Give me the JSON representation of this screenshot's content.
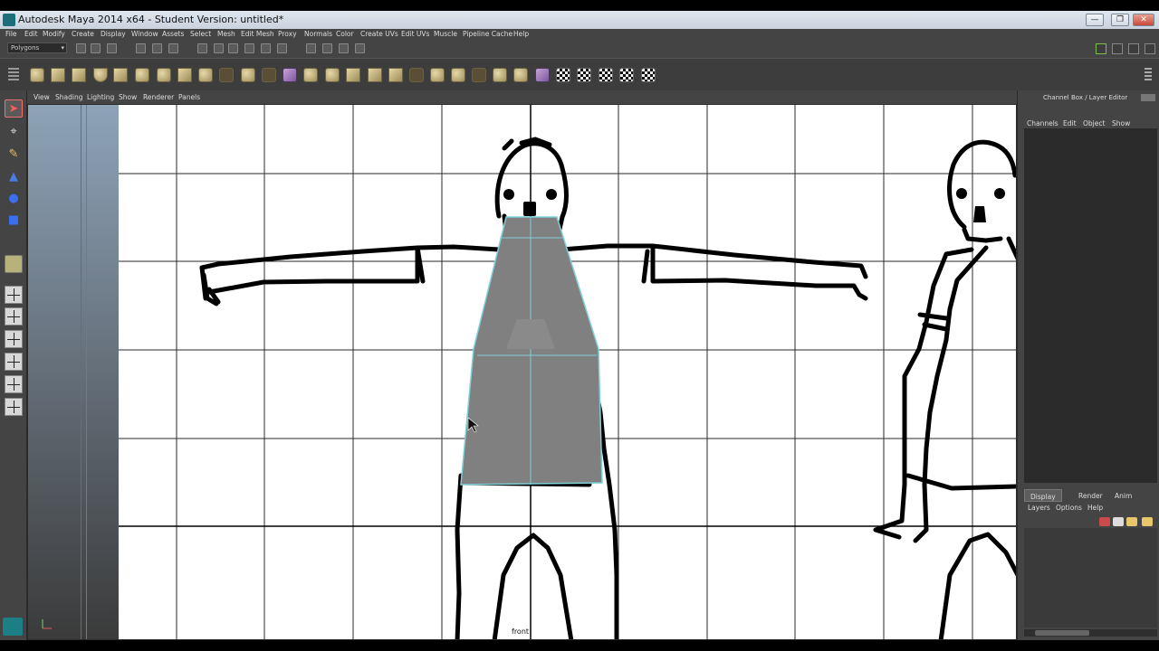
{
  "window": {
    "title": "Autodesk Maya 2014 x64 - Student Version: untitled*",
    "minimize": "—",
    "maximize": "❐",
    "close": "✕"
  },
  "menubar": [
    "File",
    "Edit",
    "Modify",
    "Create",
    "Display",
    "Window",
    "Assets",
    "Select",
    "Mesh",
    "Edit Mesh",
    "Proxy",
    "Normals",
    "Color",
    "Create UVs",
    "Edit UVs",
    "Muscle",
    "Pipeline Cache",
    "Help"
  ],
  "status": {
    "mode": "Polygons",
    "mode_arrow": "▾"
  },
  "panel_menu": [
    "View",
    "Shading",
    "Lighting",
    "Show",
    "Renderer",
    "Panels"
  ],
  "viewport": {
    "camera": "front"
  },
  "channel_box": {
    "title": "Channel Box / Layer Editor",
    "menu": [
      "Channels",
      "Edit",
      "Object",
      "Show"
    ],
    "tabs": [
      "Display",
      "Render",
      "Anim"
    ],
    "active_tab": "Display",
    "layer_menu": [
      "Layers",
      "Options",
      "Help"
    ]
  },
  "colors": {
    "selection_wire": "#7fd0d8",
    "mesh_fill": "#808080",
    "grid": "#2a2a2a",
    "ui_bg": "#444444"
  }
}
